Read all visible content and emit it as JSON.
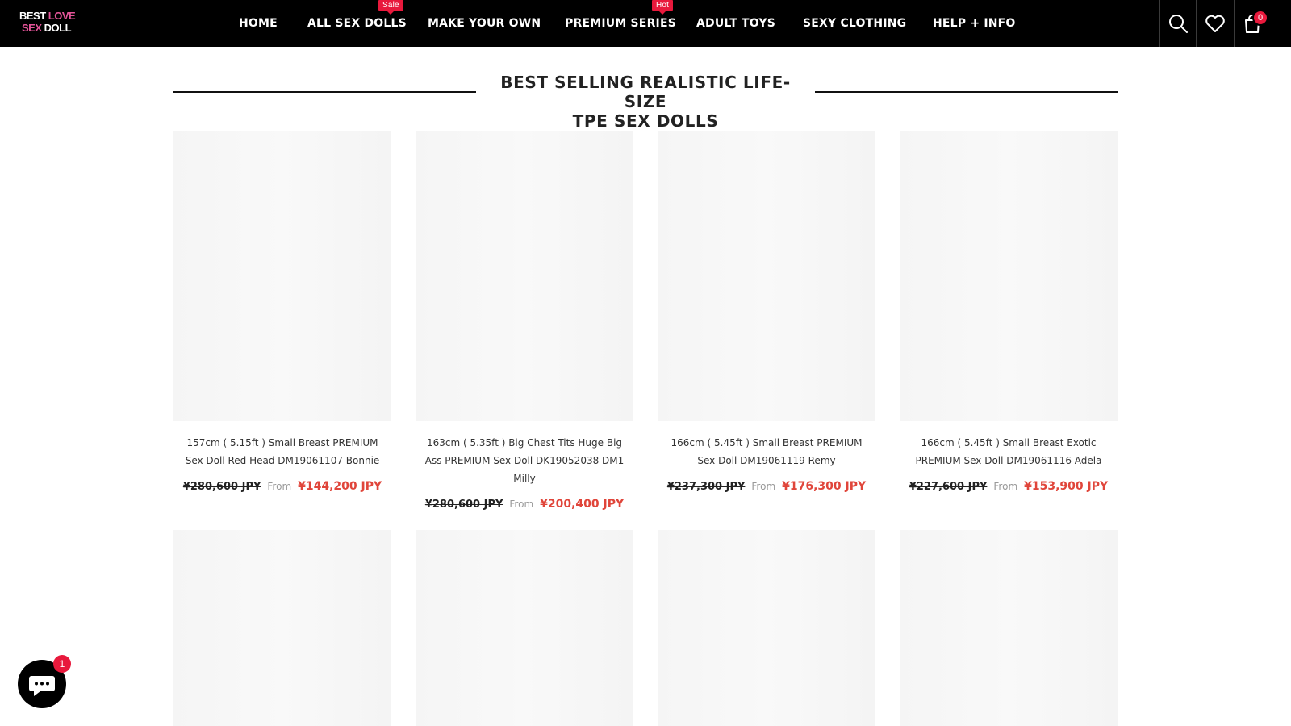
{
  "header": {
    "logo": {
      "line1_a": "BEST",
      "line1_b": "LOVE",
      "line2_a": "SEX",
      "line2_b": "DOLL"
    },
    "nav": [
      {
        "label": "HOME",
        "badge": ""
      },
      {
        "label": "ALL SEX DOLLS",
        "badge": "Sale"
      },
      {
        "label": "MAKE YOUR OWN",
        "badge": ""
      },
      {
        "label": "PREMIUM SERIES",
        "badge": "Hot"
      },
      {
        "label": "ADULT TOYS",
        "badge": ""
      },
      {
        "label": "SEXY CLOTHING",
        "badge": ""
      },
      {
        "label": "HELP + INFO",
        "badge": ""
      }
    ],
    "icons": [
      "search-icon",
      "heart-icon",
      "cart-icon"
    ],
    "cart_count": "0"
  },
  "section": {
    "title_line1": "BEST SELLING REALISTIC LIFE-SIZE",
    "title_line2": "TPE SEX DOLLS"
  },
  "products": [
    {
      "name": "157cm ( 5.15ft ) Small Breast PREMIUM Sex Doll Red Head DM19061107 Bonnie",
      "old_price": "¥280,600 JPY",
      "from": "From",
      "price": "¥144,200 JPY"
    },
    {
      "name": "163cm ( 5.35ft ) Big Chest Tits Huge Big Ass PREMIUM Sex Doll DK19052038 DM1 Milly",
      "old_price": "¥280,600 JPY",
      "from": "From",
      "price": "¥200,400 JPY"
    },
    {
      "name": "166cm ( 5.45ft ) Small Breast PREMIUM Sex Doll DM19061119 Remy",
      "old_price": "¥237,300 JPY",
      "from": "From",
      "price": "¥176,300 JPY"
    },
    {
      "name": "166cm ( 5.45ft ) Small Breast Exotic PREMIUM Sex Doll DM19061116 Adela",
      "old_price": "¥227,600 JPY",
      "from": "From",
      "price": "¥153,900 JPY"
    }
  ],
  "chat": {
    "icon": "chat-icon",
    "badge": "1"
  },
  "colors": {
    "header_bg": "#000000",
    "badge_red": "#e8193c",
    "price_red": "#e0453a",
    "logo_pink": "#e6559a"
  }
}
